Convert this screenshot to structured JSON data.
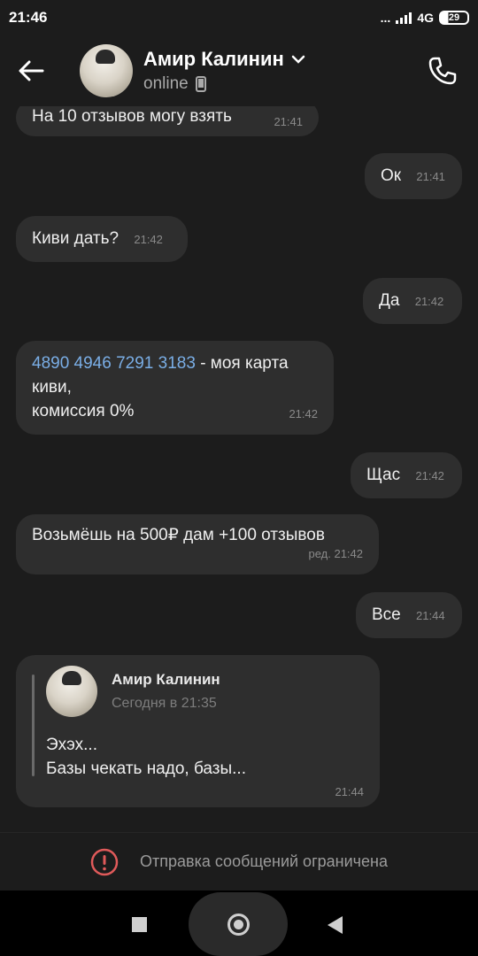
{
  "status_bar": {
    "time": "21:46",
    "network": "4G",
    "battery": "29",
    "indicator_dots": "..."
  },
  "header": {
    "name": "Амир Калинин",
    "status": "online"
  },
  "messages": [
    {
      "direction": "in",
      "text": "На 10 отзывов могу взять",
      "time": "21:41"
    },
    {
      "direction": "out",
      "text": "Ок",
      "time": "21:41"
    },
    {
      "direction": "in",
      "text": "Киви дать?",
      "time": "21:42"
    },
    {
      "direction": "out",
      "text": "Да",
      "time": "21:42"
    },
    {
      "direction": "in",
      "link": "4890 4946 7291 3183",
      "text_after_link": " - моя карта",
      "line2": "киви,",
      "line3": "комиссия 0%",
      "time": "21:42"
    },
    {
      "direction": "out",
      "text": "Щас",
      "time": "21:42"
    },
    {
      "direction": "in",
      "text": "Возьмёшь на 500₽ дам +100 отзывов",
      "time": "ред. 21:42"
    },
    {
      "direction": "out",
      "text": "Все",
      "time": "21:44"
    }
  ],
  "forwarded": {
    "author": "Амир Калинин",
    "date": "Сегодня в 21:35",
    "line1": "Эхэх...",
    "line2": "Базы чекать надо, базы...",
    "time": "21:44"
  },
  "restriction": {
    "text": "Отправка сообщений ограничена"
  },
  "colors": {
    "background": "#1c1c1c",
    "bubble": "#2e2e2e",
    "link": "#7aaee6",
    "warning": "#e05a5a"
  }
}
